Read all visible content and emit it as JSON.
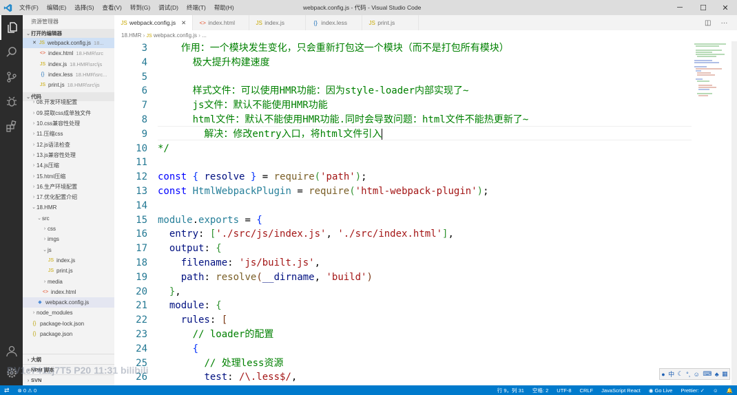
{
  "window": {
    "title": "webpack.config.js - 代码 - Visual Studio Code",
    "menu": [
      "文件(F)",
      "编辑(E)",
      "选择(S)",
      "查看(V)",
      "转到(G)",
      "调试(D)",
      "终端(T)",
      "帮助(H)"
    ]
  },
  "sidebar": {
    "title": "资源管理器",
    "open_editors_label": "打开的编辑器",
    "open_editors": [
      {
        "name": "webpack.config.js",
        "desc": "18...",
        "icon": "js",
        "close": "✕"
      },
      {
        "name": "index.html",
        "desc": "18.HMR\\src",
        "icon": "html"
      },
      {
        "name": "index.js",
        "desc": "18.HMR\\src\\js",
        "icon": "js"
      },
      {
        "name": "index.less",
        "desc": "18.HMR\\src...",
        "icon": "less"
      },
      {
        "name": "print.js",
        "desc": "18.HMR\\src\\js",
        "icon": "js"
      }
    ],
    "folder_label": "代码",
    "tree": [
      "08.开发环境配置",
      "09.提取css成单独文件",
      "10.css兼容性处理",
      "11.压缩css",
      "12.js语法检查",
      "13.js兼容性处理",
      "14.js压缩",
      "15.html压缩",
      "16.生产环境配置",
      "17.优化配置介绍",
      "18.HMR",
      "src",
      "css",
      "imgs",
      "js",
      "index.js",
      "print.js",
      "media",
      "index.html",
      "webpack.config.js",
      "node_modules",
      "package-lock.json",
      "package.json"
    ],
    "bottom_sections": [
      "大纲",
      "NPM 脚本",
      "SVN"
    ]
  },
  "tabs": [
    {
      "label": "webpack.config.js",
      "icon": "js",
      "active": true,
      "close": "✕"
    },
    {
      "label": "index.html",
      "icon": "html"
    },
    {
      "label": "index.js",
      "icon": "js"
    },
    {
      "label": "index.less",
      "icon": "less"
    },
    {
      "label": "print.js",
      "icon": "js"
    }
  ],
  "breadcrumb": [
    "18.HMR",
    "webpack.config.js",
    "..."
  ],
  "editor": {
    "line_numbers": [
      "3",
      "4",
      "5",
      "6",
      "7",
      "8",
      "9",
      "10",
      "11",
      "12",
      "13",
      "14",
      "15",
      "16",
      "17",
      "18",
      "19",
      "20",
      "21",
      "22",
      "23",
      "24",
      "25",
      "26"
    ]
  },
  "status": {
    "position": "行 9，列 31",
    "spaces": "空格: 2",
    "encoding": "UTF-8",
    "eol": "CRLF",
    "language": "JavaScript React",
    "golive": "Go Live",
    "prettier": "Prettier: ✓"
  },
  "ime": {
    "lang": "中"
  },
  "watermark": "BV1e7411j7T5 P20 11:31 bilibili",
  "colors": {
    "statusbar": "#007acc",
    "activitybar": "#2c2c2c",
    "titlebar": "#dddddd"
  }
}
